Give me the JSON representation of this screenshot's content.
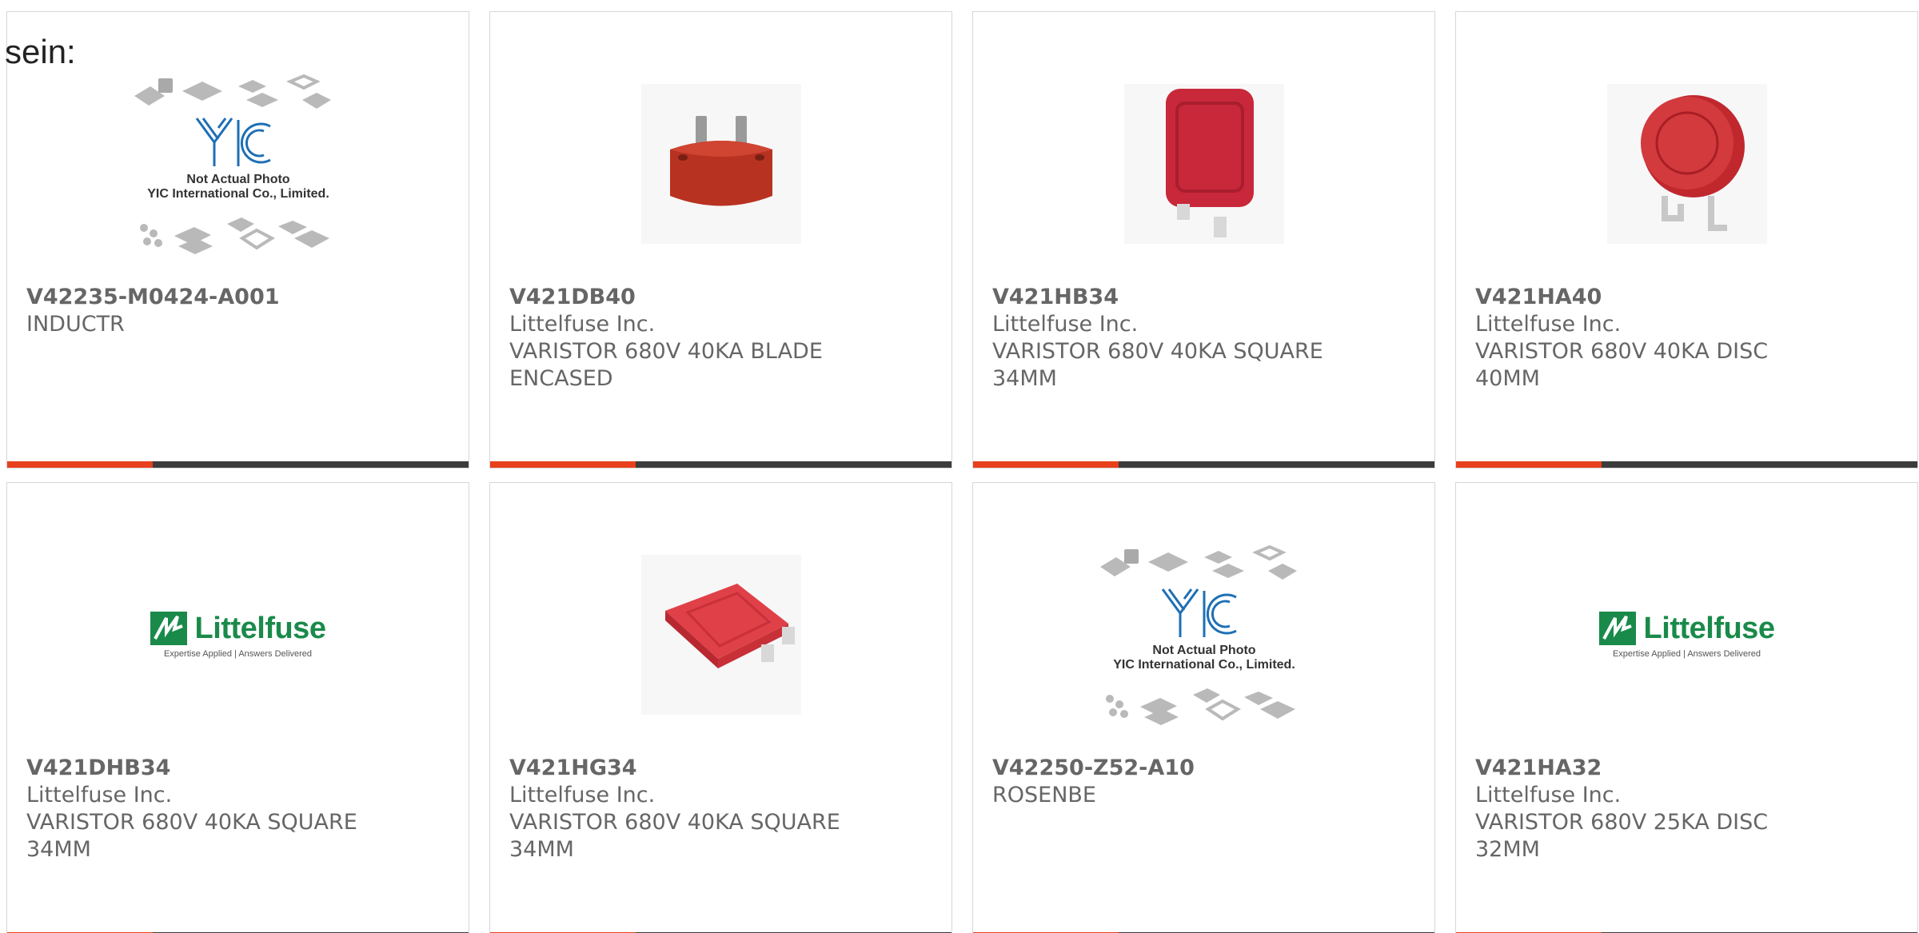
{
  "stray_text": "sein:",
  "colors": {
    "accent_bar": "#e8401c",
    "dark_bar": "#3c3c3c",
    "text_gray": "#666666",
    "card_border": "#d6d6d6",
    "littelfuse_green": "#1a8a4a",
    "varistor_red": "#c8283a",
    "yic_blue": "#1e6fb5"
  },
  "placeholders": {
    "yic": {
      "line1": "Not Actual Photo",
      "line2": "YIC International Co., Limited."
    },
    "littelfuse": {
      "brand": "Littelfuse",
      "tagline": "Expertise Applied | Answers Delivered"
    }
  },
  "products": [
    {
      "part": "V42235-M0424-A001",
      "manufacturer": "",
      "desc1": "INDUCTR",
      "desc2": "",
      "image": "yic-placeholder"
    },
    {
      "part": "V421DB40",
      "manufacturer": "Littelfuse Inc.",
      "desc1": "VARISTOR 680V 40KA BLADE",
      "desc2": "ENCASED",
      "image": "varistor-blade-encased"
    },
    {
      "part": "V421HB34",
      "manufacturer": "Littelfuse Inc.",
      "desc1": "VARISTOR 680V 40KA SQUARE",
      "desc2": "34MM",
      "image": "varistor-square"
    },
    {
      "part": "V421HA40",
      "manufacturer": "Littelfuse Inc.",
      "desc1": "VARISTOR 680V 40KA DISC",
      "desc2": "40MM",
      "image": "varistor-disc"
    },
    {
      "part": "V421DHB34",
      "manufacturer": "Littelfuse Inc.",
      "desc1": "VARISTOR 680V 40KA SQUARE",
      "desc2": "34MM",
      "image": "littelfuse-logo"
    },
    {
      "part": "V421HG34",
      "manufacturer": "Littelfuse Inc.",
      "desc1": "VARISTOR 680V 40KA SQUARE",
      "desc2": "34MM",
      "image": "varistor-square-flat"
    },
    {
      "part": "V42250-Z52-A10",
      "manufacturer": "",
      "desc1": "ROSENBE",
      "desc2": "",
      "image": "yic-placeholder"
    },
    {
      "part": "V421HA32",
      "manufacturer": "Littelfuse Inc.",
      "desc1": "VARISTOR 680V 25KA DISC",
      "desc2": "32MM",
      "image": "littelfuse-logo"
    }
  ]
}
